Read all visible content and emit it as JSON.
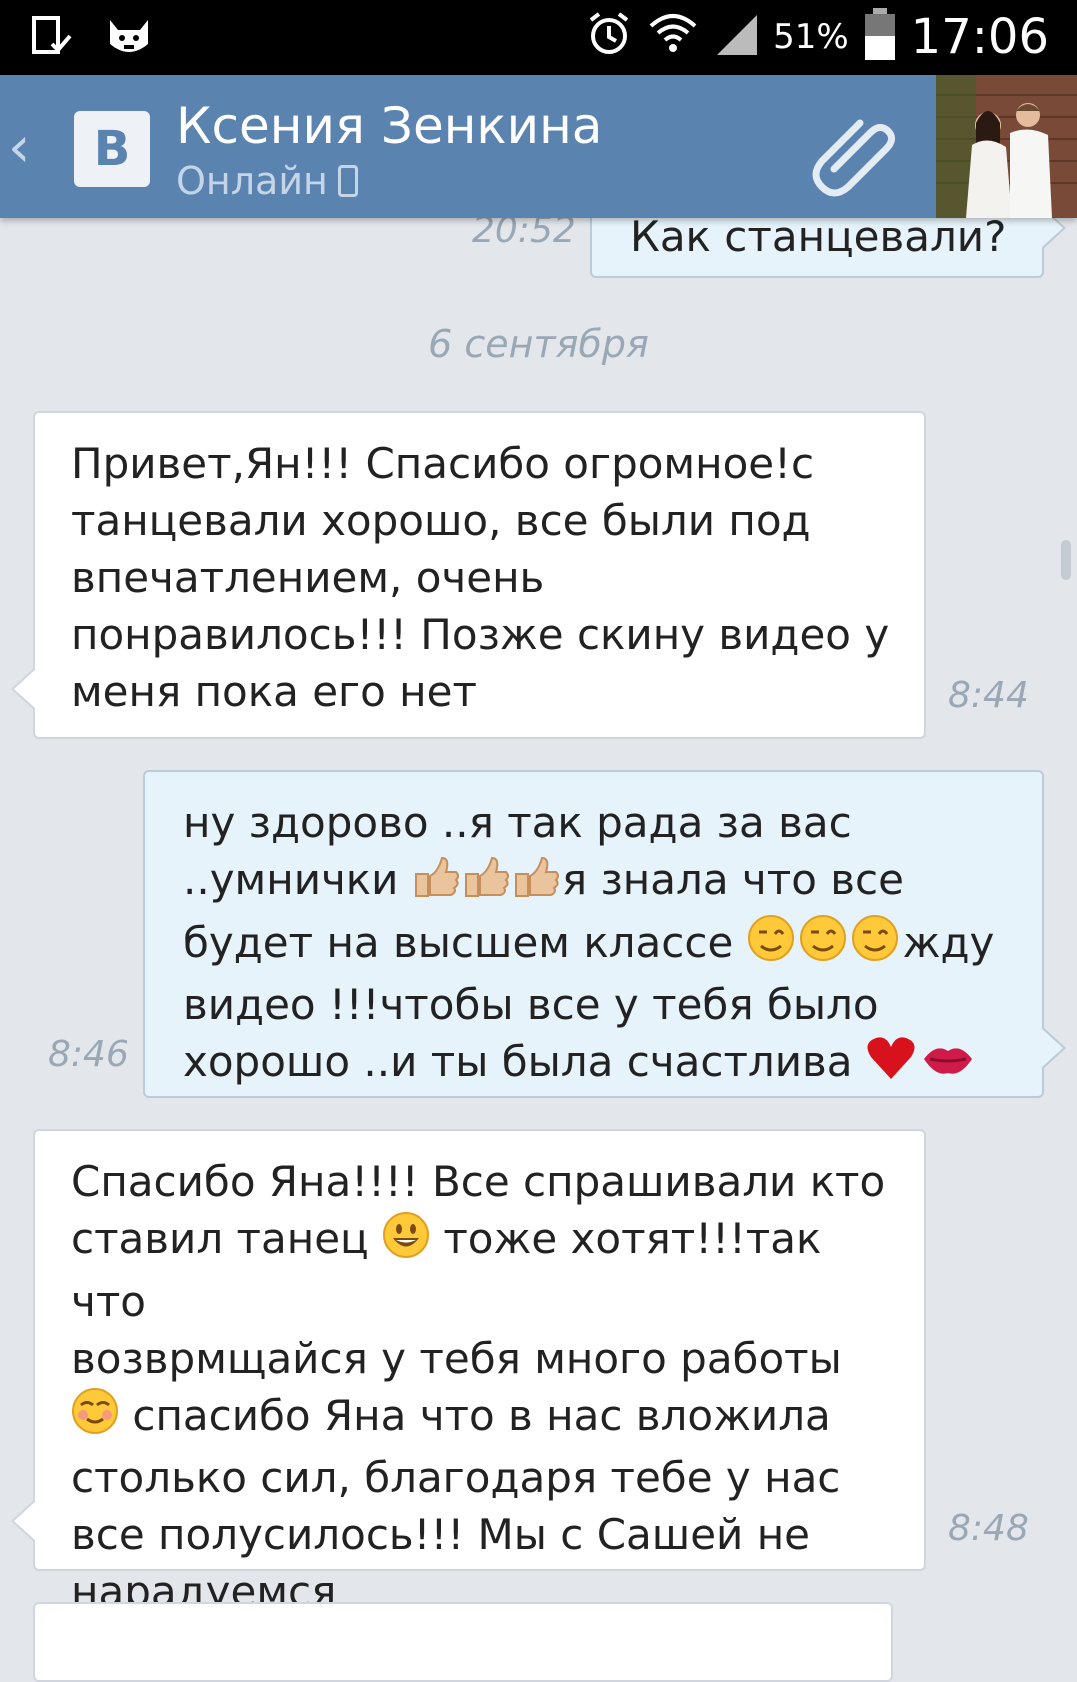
{
  "status_bar": {
    "battery_percent": "51%",
    "time": "17:06"
  },
  "header": {
    "back_icon": "chevron-left-icon",
    "logo": "В",
    "contact_name": "Ксения Зенкина",
    "contact_status": "Онлайн",
    "attach_icon": "paperclip-icon"
  },
  "messages": [
    {
      "direction": "out",
      "text": "Как станцевали?",
      "time": "20:52"
    },
    {
      "direction": "date",
      "text": "6 сентября"
    },
    {
      "direction": "in",
      "text": "Привет,Ян!!! Спасибо огромное!с\nтанцевали хорошо, все были под\nвпечатлением, очень\nпонравилось!!! Позже скину видео у\nменя пока его нет",
      "time": "8:44"
    },
    {
      "direction": "out",
      "line1": "ну здорово   ..я так рада за вас",
      "line2_a": "..умнички ",
      "line2_b": "я знала что все",
      "line3_a": "будет на высшем классе ",
      "line3_b": "жду",
      "line4": "видео !!!чтобы все у тебя было",
      "line5": "хорошо ..и ты была счастлива ",
      "time": "8:46"
    },
    {
      "direction": "in",
      "line1": "Спасибо Яна!!!! Все спрашивали кто",
      "line2_a": "ставил танец ",
      "line2_b": " тоже хотят!!!так что",
      "line3": "возврмщайся у тебя много работы",
      "line4_b": " спасибо Яна что в нас вложила",
      "line5": "столько сил, благодаря тебе у нас",
      "line6": "все полусилось!!! Мы с Сашей не",
      "line7": "нарадуемся",
      "time": "8:48"
    }
  ]
}
